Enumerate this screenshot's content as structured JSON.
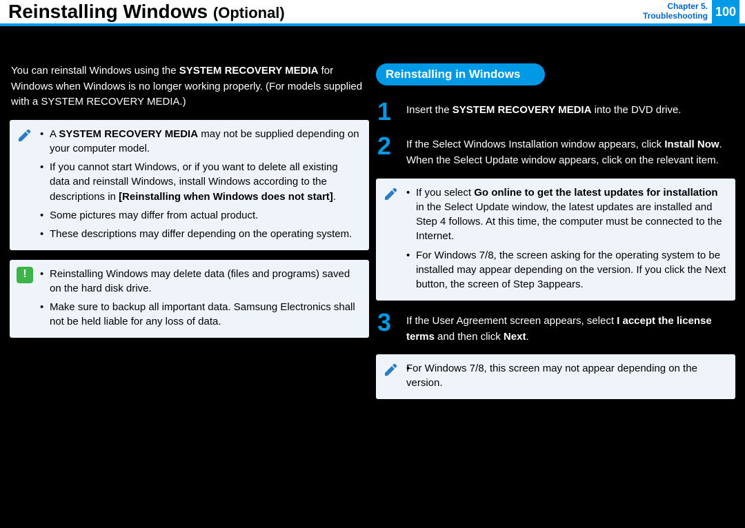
{
  "header": {
    "title_main": "Reinstalling Windows",
    "title_sub": "(Optional)",
    "chapter_line1": "Chapter 5.",
    "chapter_line2": "Troubleshooting",
    "page_number": "100"
  },
  "intro_paragraph": "You can reinstall Windows using the SYSTEM RECOVERY MEDIA for Windows when Windows is no longer working properly. (For models supplied with a SYSTEM RECOVERY MEDIA.)",
  "srm_label": "SYSTEM RECOVERY MEDIA",
  "note1": {
    "b1_prefix": "A ",
    "b1_bold": "SYSTEM RECOVERY MEDIA",
    "b1_suffix": " may not be supplied depending on your computer model.",
    "b2_prefix": "If you cannot start Windows, or if you want to delete all existing data and reinstall Windows, install Windows according to the descriptions in ",
    "b2_bold": "[Reinstalling when Windows does not start]",
    "b2_suffix": ".",
    "b3": "Some pictures may differ from actual product.",
    "b4": "These descriptions may differ depending on the operating system."
  },
  "note2": {
    "b1": "Reinstalling Windows may delete data (files and programs) saved on the hard disk drive.",
    "b2": "Make sure to backup all important data. Samsung Electronics shall not be held liable for any loss of data."
  },
  "section_heading": "Reinstalling in Windows",
  "step1": {
    "num": "1",
    "prefix": "Insert the ",
    "bold": "SYSTEM RECOVERY MEDIA",
    "suffix": " into the DVD drive."
  },
  "step2": {
    "num": "2",
    "prefix": "If the Select Windows Installation window appears, click ",
    "bold1": "Install Now",
    "mid": ". When the Select Update window appears, click on the relevant item.",
    "suffix": ""
  },
  "note3": {
    "b1_prefix": "If you select ",
    "b1_bold": "Go online to get the latest updates for installation",
    "b1_suffix": " in the Select Update window, the latest updates are installed and Step 4 follows. At this time, the computer must be connected to the Internet.",
    "b2": "For Windows 7/8, the screen asking for the operating system to be installed may appear depending on the version. If you click the Next button, the screen of Step 3appears."
  },
  "step3": {
    "num": "3",
    "prefix": "If the User Agreement screen appears, select ",
    "bold1": "I accept the license terms",
    "mid": " and then click ",
    "bold2": "Next",
    "suffix": "."
  },
  "note4": {
    "b1": "For Windows 7/8, this screen may not appear depending on the version."
  }
}
